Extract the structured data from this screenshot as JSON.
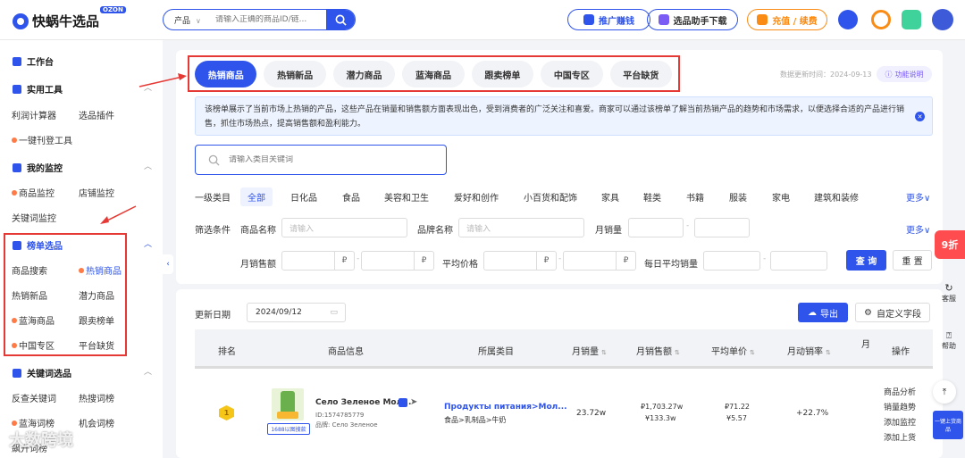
{
  "header": {
    "logo_text": "快蜗牛选品",
    "logo_badge": "OZON",
    "search_category": "产品",
    "search_placeholder": "请输入正确的商品ID/链...",
    "promo_button": "推广赚钱",
    "assistant_button": "选品助手下载",
    "recharge_button": "充值 / 续费"
  },
  "sidebar": {
    "workbench": "工作台",
    "tools_header": "实用工具",
    "tools_items": [
      "利润计算器",
      "选品插件",
      "一键刊登工具"
    ],
    "monitor_header": "我的监控",
    "monitor_items": [
      "商品监控",
      "店铺监控",
      "关键词监控"
    ],
    "ranking_header": "榜单选品",
    "ranking_items": [
      "商品搜索",
      "热销商品",
      "热销新品",
      "潜力商品",
      "蓝海商品",
      "跟卖榜单",
      "中国专区",
      "平台缺货"
    ],
    "keyword_header": "关键词选品",
    "keyword_items": [
      "反查关键词",
      "热搜词榜",
      "蓝海词榜",
      "机会词榜",
      "飙升词榜"
    ]
  },
  "tabs": [
    "热销商品",
    "热销新品",
    "潜力商品",
    "蓝海商品",
    "跟卖榜单",
    "中国专区",
    "平台缺货"
  ],
  "update_time": "数据更新时间：2024-09-13",
  "help_label": "功能说明",
  "notice": "该榜单展示了当前市场上热销的产品，这些产品在销量和销售额方面表现出色，受到消费者的广泛关注和喜爱。商家可以通过该榜单了解当前热销产品的趋势和市场需求，以便选择合适的产品进行销售，抓住市场热点，提高销售额和盈利能力。",
  "category_search_placeholder": "请输入类目关键词",
  "filters": {
    "category_label": "一级类目",
    "categories": [
      "全部",
      "日化品",
      "食品",
      "美容和卫生",
      "爱好和创作",
      "小百货和配饰",
      "家具",
      "鞋类",
      "书籍",
      "服装",
      "家电",
      "建筑和装修"
    ],
    "more": "更多",
    "condition_label": "筛选条件",
    "product_name_label": "商品名称",
    "product_name_placeholder": "请输入",
    "brand_label": "品牌名称",
    "brand_placeholder": "请输入",
    "monthly_sales_label": "月销量",
    "monthly_revenue_label": "月销售额",
    "avg_price_label": "平均价格",
    "daily_avg_label": "每日平均销量",
    "currency": "₽",
    "query_button": "查 询",
    "reset_button": "重 置"
  },
  "table_toolbar": {
    "date_label": "更新日期",
    "date_value": "2024/09/12",
    "export_button": "导出",
    "custom_fields_button": "自定义字段"
  },
  "table": {
    "headers": [
      "排名",
      "商品信息",
      "所属类目",
      "月销量",
      "月销售额",
      "平均单价",
      "月动销率",
      "月",
      "操作"
    ],
    "rows": [
      {
        "rank": "1",
        "name": "Село Зеленое Мол...",
        "id": "ID:1574785779",
        "brand": "品牌: Село Зеленое",
        "tag": "1688以图搜款",
        "category": "Продукты питания>Мол...",
        "category_cn": "食品>乳制品>牛奶",
        "monthly_sales": "23.72w",
        "revenue_rub": "₽1,703.27w",
        "revenue_cny": "¥133.3w",
        "price_rub": "₽71.22",
        "price_cny": "¥5.57",
        "sell_through": "+22.7%",
        "actions": [
          "商品分析",
          "销量趋势",
          "添加监控",
          "添加上货"
        ]
      }
    ]
  },
  "right_rail": {
    "discount": "9折",
    "service": "客服",
    "help": "帮助",
    "upload": "一键上货商品"
  },
  "watermark": "大数跨境"
}
